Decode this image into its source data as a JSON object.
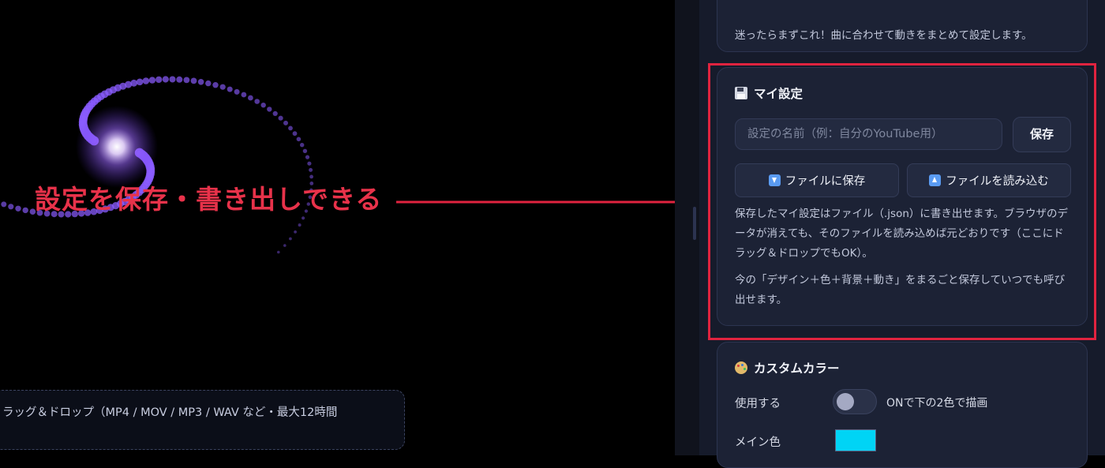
{
  "annotation": {
    "text": "設定を保存・書き出しできる"
  },
  "dropzone": {
    "text": "ラッグ＆ドロップ（MP4 / MOV / MP3 / WAV など・最大12時間"
  },
  "preset_card": {
    "description": "迷ったらまずこれ！曲に合わせて動きをまとめて設定します。"
  },
  "my_settings": {
    "title": "マイ設定",
    "icon": "floppy-disk-icon",
    "name_placeholder": "設定の名前（例：自分のYouTube用）",
    "save_label": "保存",
    "save_file_label": "ファイルに保存",
    "load_file_label": "ファイルを読み込む",
    "desc1": "保存したマイ設定はファイル（.json）に書き出せます。ブラウザのデータが消えても、そのファイルを読み込めば元どおりです（ここにドラッグ＆ドロップでもOK）。",
    "desc2": "今の「デザイン＋色＋背景＋動き」をまるごと保存していつでも呼び出せます。"
  },
  "custom_color": {
    "title": "カスタムカラー",
    "icon": "palette-icon",
    "use_label": "使用する",
    "use_enabled": false,
    "toggle_note": "ONで下の2色で描画",
    "main_color_label": "メイン色",
    "main_color": "#00d4f5"
  },
  "colors": {
    "highlight": "#e0233f",
    "annotation": "#e8324a",
    "particle": "#8a5cff"
  }
}
